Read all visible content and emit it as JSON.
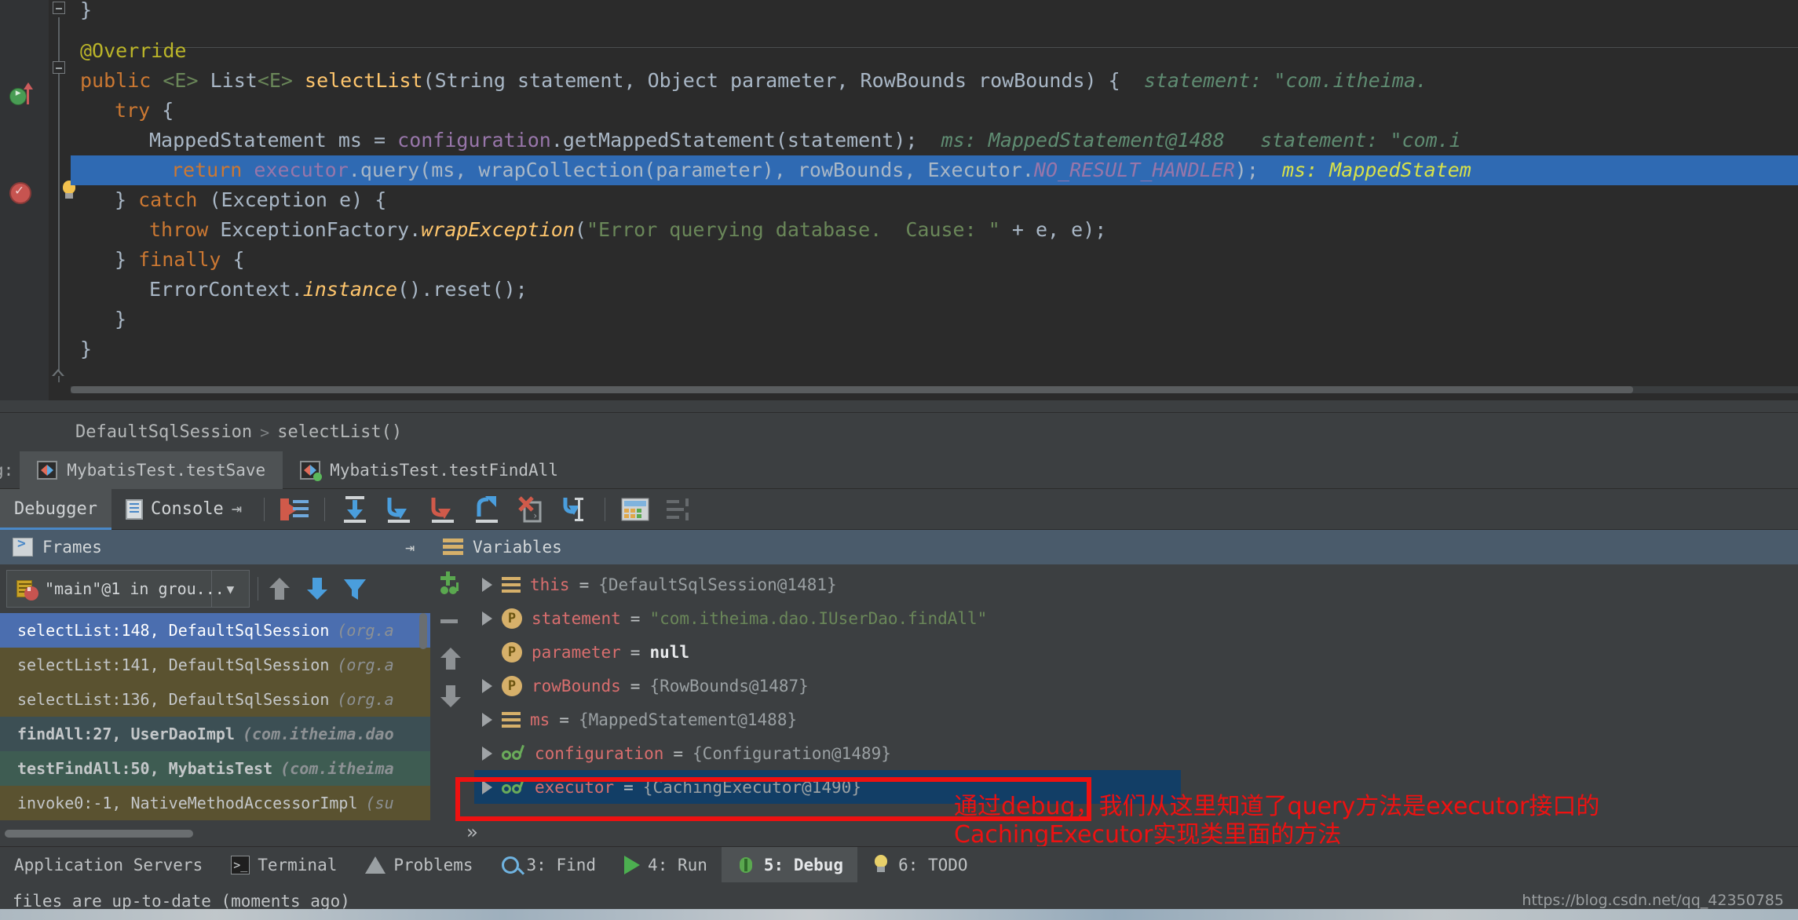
{
  "editor": {
    "lines": [
      {
        "indent": 0,
        "text": "}"
      },
      {
        "indent": 0,
        "text": ""
      },
      {
        "indent": 1,
        "text": "@Override"
      },
      {
        "indent": 1,
        "text": "public <E> List<E> selectList(String statement, Object parameter, RowBounds rowBounds) {",
        "hint": "statement: \"com.itheima."
      },
      {
        "indent": 2,
        "text": "try {"
      },
      {
        "indent": 3,
        "text": "MappedStatement ms = configuration.getMappedStatement(statement);",
        "hint": "ms: MappedStatement@1488   statement: \"com.i"
      },
      {
        "indent": 3,
        "text": "return executor.query(ms, wrapCollection(parameter), rowBounds, Executor.NO_RESULT_HANDLER);",
        "hint": "ms: MappedStatem",
        "highlighted": true
      },
      {
        "indent": 2,
        "text": "} catch (Exception e) {"
      },
      {
        "indent": 3,
        "text": "throw ExceptionFactory.wrapException(\"Error querying database.  Cause: \" + e, e);"
      },
      {
        "indent": 2,
        "text": "} finally {"
      },
      {
        "indent": 3,
        "text": "ErrorContext.instance().reset();"
      },
      {
        "indent": 2,
        "text": "}"
      },
      {
        "indent": 1,
        "text": "}"
      }
    ]
  },
  "breadcrumb": {
    "class_name": "DefaultSqlSession",
    "separator": ">",
    "method_name": "selectList()"
  },
  "run_tabs": {
    "label": "g:",
    "tabs": [
      {
        "name": "MybatisTest.testSave",
        "active": true,
        "running": false
      },
      {
        "name": "MybatisTest.testFindAll",
        "active": false,
        "running": true
      }
    ]
  },
  "debug_toolbar": {
    "tabs": [
      {
        "label": "Debugger",
        "active": true
      },
      {
        "label": "Console",
        "active": false
      }
    ],
    "pin_label": "⇥",
    "buttons": [
      {
        "name": "show-execution-point-button",
        "title": "Show Execution Point"
      },
      {
        "name": "step-over-button",
        "title": "Step Over"
      },
      {
        "name": "step-into-button",
        "title": "Step Into"
      },
      {
        "name": "force-step-into-button",
        "title": "Force Step Into"
      },
      {
        "name": "step-out-button",
        "title": "Step Out"
      },
      {
        "name": "drop-frame-button",
        "title": "Drop Frame"
      },
      {
        "name": "run-to-cursor-button",
        "title": "Run to Cursor"
      },
      {
        "name": "evaluate-expression-button",
        "title": "Evaluate Expression"
      },
      {
        "name": "layout-settings-button",
        "title": "Layout"
      }
    ]
  },
  "frames": {
    "title": "Frames",
    "thread": "\"main\"@1 in grou...",
    "rows": [
      {
        "method": "selectList:148,",
        "cls": "DefaultSqlSession",
        "pkg": "(org.a",
        "style": "sel"
      },
      {
        "method": "selectList:141,",
        "cls": "DefaultSqlSession",
        "pkg": "(org.a",
        "style": "lib"
      },
      {
        "method": "selectList:136,",
        "cls": "DefaultSqlSession",
        "pkg": "(org.a",
        "style": "lib"
      },
      {
        "method": "findAll:27,",
        "cls": "UserDaoImpl",
        "pkg": "(com.itheima.dao",
        "style": "own"
      },
      {
        "method": "testFindAll:50,",
        "cls": "MybatisTest",
        "pkg": "(com.itheima",
        "style": "test"
      },
      {
        "method": "invoke0:-1,",
        "cls": "NativeMethodAccessorImpl",
        "pkg": "(su",
        "style": "lib"
      }
    ]
  },
  "variables": {
    "title": "Variables",
    "more_label": "»",
    "rows": [
      {
        "icon": "obj",
        "expandable": true,
        "name": "this",
        "value": "{DefaultSqlSession@1481}",
        "value_kind": "obj"
      },
      {
        "icon": "param",
        "expandable": true,
        "name": "statement",
        "value": "\"com.itheima.dao.IUserDao.findAll\"",
        "value_kind": "str"
      },
      {
        "icon": "param",
        "expandable": false,
        "name": "parameter",
        "value": "null",
        "value_kind": "null"
      },
      {
        "icon": "param",
        "expandable": true,
        "name": "rowBounds",
        "value": "{RowBounds@1487}",
        "value_kind": "obj"
      },
      {
        "icon": "obj",
        "expandable": true,
        "name": "ms",
        "value": "{MappedStatement@1488}",
        "value_kind": "obj"
      },
      {
        "icon": "field",
        "expandable": true,
        "name": "configuration",
        "value": "{Configuration@1489}",
        "value_kind": "obj"
      },
      {
        "icon": "field",
        "expandable": true,
        "name": "executor",
        "value": "{CachingExecutor@1490}",
        "value_kind": "obj",
        "selected": true,
        "annotated": true
      }
    ]
  },
  "annotation": {
    "line1": "通过debug，我们从这里知道了query方法是executor接口的",
    "line2": "CachingExecutor实现类里面的方法",
    "color": "#ee1111"
  },
  "toolwindow_bar": {
    "items": [
      {
        "label": "Application Servers",
        "icon": "none",
        "active": false
      },
      {
        "label": "Terminal",
        "icon": "terminal",
        "active": false
      },
      {
        "label": "Problems",
        "icon": "warning",
        "active": false
      },
      {
        "label": "3: Find",
        "icon": "find",
        "active": false,
        "mnemonic": "3"
      },
      {
        "label": "4: Run",
        "icon": "run",
        "active": false,
        "mnemonic": "4"
      },
      {
        "label": "5: Debug",
        "icon": "debug",
        "active": true,
        "mnemonic": "5"
      },
      {
        "label": "6: TODO",
        "icon": "todo",
        "active": false,
        "mnemonic": "6"
      }
    ]
  },
  "status": {
    "message": "files are up-to-date (moments ago)"
  },
  "watermark": {
    "text": "https://blog.csdn.net/qq_42350785"
  },
  "colors": {
    "editor_bg": "#2b2b2b",
    "panel_bg": "#3c3f41",
    "selection_blue": "#2f6ab3",
    "frame_selected": "#4b6eaf",
    "annotation_red": "#ee1111",
    "header_blue": "#4a5b6b"
  }
}
